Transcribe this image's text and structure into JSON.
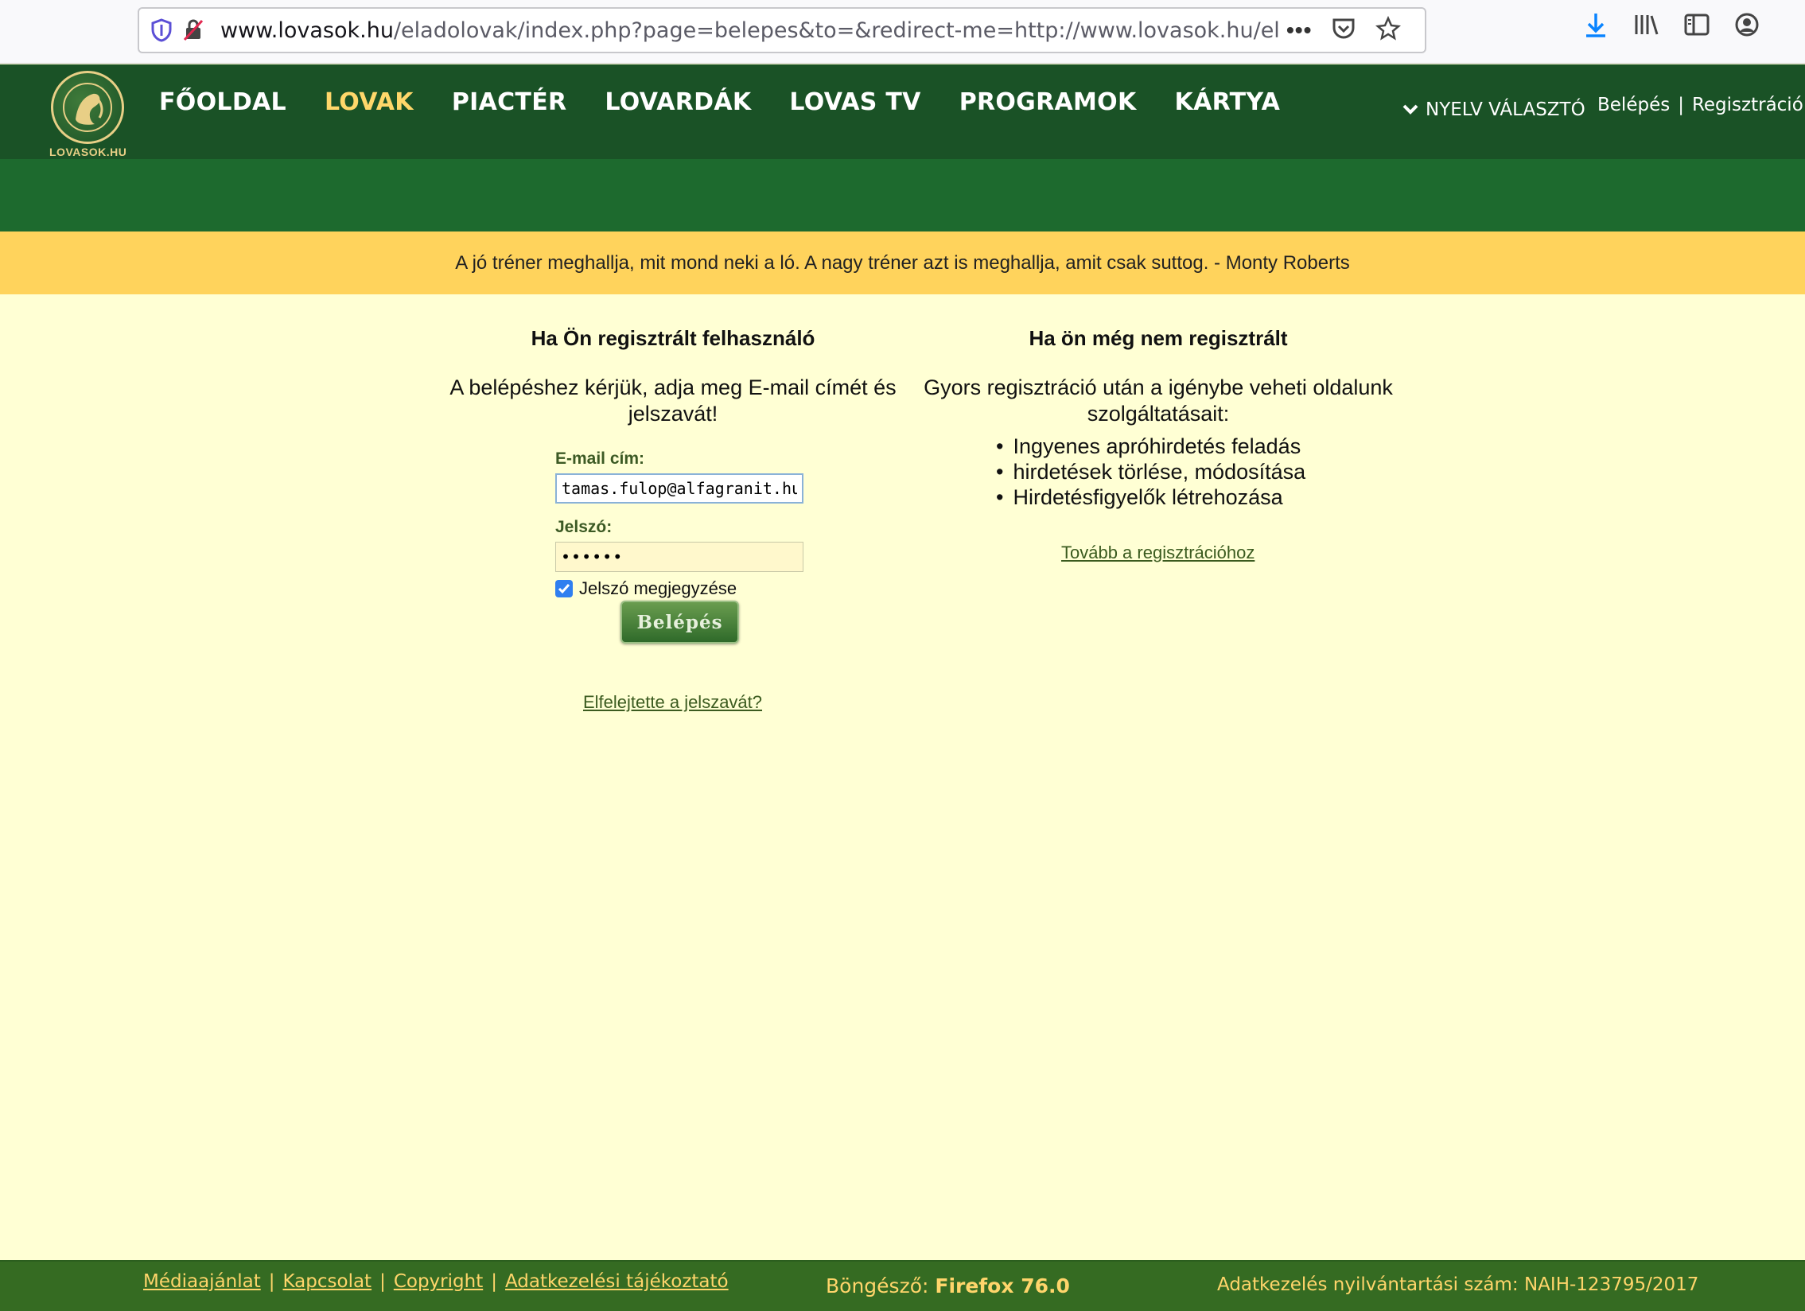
{
  "browser": {
    "url_host": "www.lovasok.hu",
    "url_path": "/eladolovak/index.php?page=belepes&to=&redirect-me=http://www.lovasok.hu/eladolov",
    "icons": [
      "shield-icon",
      "tracking-blocked-icon",
      "more-icon",
      "pocket-icon",
      "star-icon",
      "download-icon",
      "library-icon",
      "sidebar-icon",
      "account-icon"
    ]
  },
  "site": {
    "logo_text": "LOVASOK.HU",
    "nav": [
      {
        "label": "FŐOLDAL"
      },
      {
        "label": "LOVAK",
        "active": true
      },
      {
        "label": "PIACTÉR"
      },
      {
        "label": "LOVARDÁK"
      },
      {
        "label": "LOVAS TV"
      },
      {
        "label": "PROGRAMOK"
      },
      {
        "label": "KÁRTYA"
      }
    ],
    "language_selector": "NYELV VÁLASZTÓ",
    "login_link": "Belépés",
    "auth_separator": "|",
    "register_link": "Regisztráció"
  },
  "quote": "A jó tréner meghallja, mit mond neki a ló. A nagy tréner azt is meghallja, amit csak suttog. - Monty Roberts",
  "login": {
    "heading": "Ha Ön regisztrált felhasználó",
    "instruction": "A belépéshez kérjük, adja meg E-mail címét és jelszavát!",
    "email_label": "E-mail cím:",
    "email_value": "tamas.fulop@alfagranit.hu",
    "password_label": "Jelszó:",
    "password_value": "••••••",
    "remember_label": "Jelszó megjegyzése",
    "remember_checked": true,
    "submit_label": "Belépés",
    "forgot_link": "Elfelejtette a jelszavát?"
  },
  "register": {
    "heading": "Ha ön még nem regisztrált",
    "description": "Gyors regisztráció után a igénybe veheti oldalunk szolgáltatásait:",
    "benefits": [
      "Ingyenes apróhirdetés feladás",
      "hirdetések törlése, módosítása",
      "Hirdetésfigyelők létrehozása"
    ],
    "register_link": "Tovább a regisztrációhoz"
  },
  "footer": {
    "links": [
      "Médiaajánlat",
      "Kapcsolat",
      "Copyright",
      "Adatkezelési tájékoztató"
    ],
    "separator": "|",
    "browser_label": "Böngésző:",
    "browser_value": "Firefox 76.0",
    "naih": "Adatkezelés nyilvántartási szám: NAIH-123795/2017"
  },
  "colors": {
    "header_green": "#1a5226",
    "band_green": "#1d6a2e",
    "quote_yellow": "#ffd35c",
    "page_bg": "#ffffd4",
    "nav_active": "#ffd76a",
    "footer_green": "#356b22"
  }
}
